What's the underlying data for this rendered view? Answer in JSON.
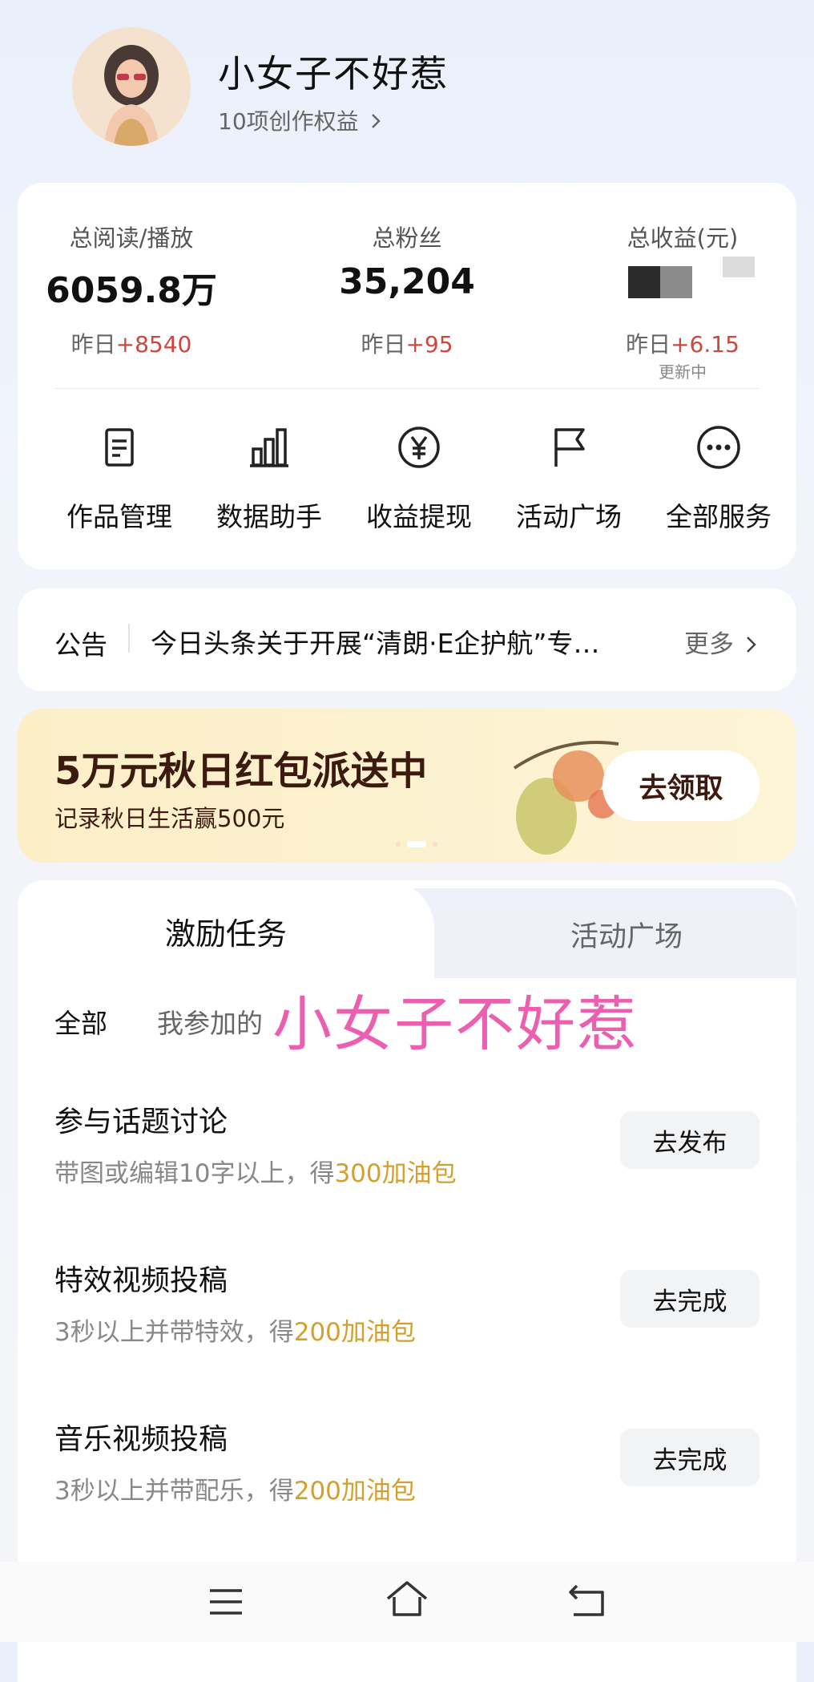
{
  "profile": {
    "name": "小女子不好惹",
    "benefits": "10项创作权益"
  },
  "stats": [
    {
      "label": "总阅读/播放",
      "value": "6059.8万",
      "delta_prefix": "昨日",
      "delta_value": "+8540"
    },
    {
      "label": "总粉丝",
      "value": "35,204",
      "delta_prefix": "昨日",
      "delta_value": "+95"
    },
    {
      "label": "总收益(元)",
      "value": "",
      "delta_prefix": "昨日",
      "delta_value": "+6.15",
      "note": "更新中"
    }
  ],
  "services": [
    {
      "label": "作品管理",
      "icon": "document-icon"
    },
    {
      "label": "数据助手",
      "icon": "bar-chart-icon"
    },
    {
      "label": "收益提现",
      "icon": "yuan-icon"
    },
    {
      "label": "活动广场",
      "icon": "flag-icon"
    },
    {
      "label": "全部服务",
      "icon": "more-icon"
    }
  ],
  "notice": {
    "label": "公告",
    "text": "今日头条关于开展“清朗·E企护航”专…",
    "more": "更多"
  },
  "banner": {
    "title": "5万元秋日红包派送中",
    "subtitle": "记录秋日生活赢500元",
    "button": "去领取"
  },
  "tabs": [
    "激励任务",
    "活动广场"
  ],
  "filters": [
    "全部",
    "我参加的"
  ],
  "watermark": "小女子不好惹",
  "tasks": [
    {
      "title": "参与话题讨论",
      "desc_pre": "带图或编辑10字以上，得",
      "reward": "300加油包",
      "button": "去发布"
    },
    {
      "title": "特效视频投稿",
      "desc_pre": "3秒以上并带特效，得",
      "reward": "200加油包",
      "button": "去完成"
    },
    {
      "title": "音乐视频投稿",
      "desc_pre": "3秒以上并带配乐，得",
      "reward": "200加油包",
      "button": "去完成"
    }
  ],
  "colors": {
    "accent_red": "#d0453c",
    "reward_gold": "#d4a02c",
    "watermark_pink": "#ec5fb0",
    "banner_bg": "#fcefc8"
  }
}
